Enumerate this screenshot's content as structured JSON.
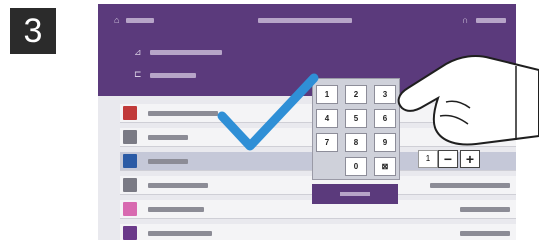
{
  "step_number": "3",
  "keypad": {
    "keys": [
      "1",
      "2",
      "3",
      "4",
      "5",
      "6",
      "7",
      "8",
      "9",
      "0"
    ],
    "clear_symbol": "⊠"
  },
  "stepper": {
    "value": "1",
    "minus": "−",
    "plus": "+"
  },
  "colors": {
    "header": "#5b3a7c",
    "check": "#2f8fd6",
    "tile_red": "#c13a3a",
    "tile_blue": "#2a5aa6",
    "tile_gray": "#7a7a84",
    "tile_pink": "#d86ab0",
    "tile_purple": "#6b3a8a"
  },
  "icons": {
    "header_left": "home-icon",
    "header_right": "headset-icon",
    "check": "checkmark-icon",
    "hand": "hand-pointing-icon"
  }
}
